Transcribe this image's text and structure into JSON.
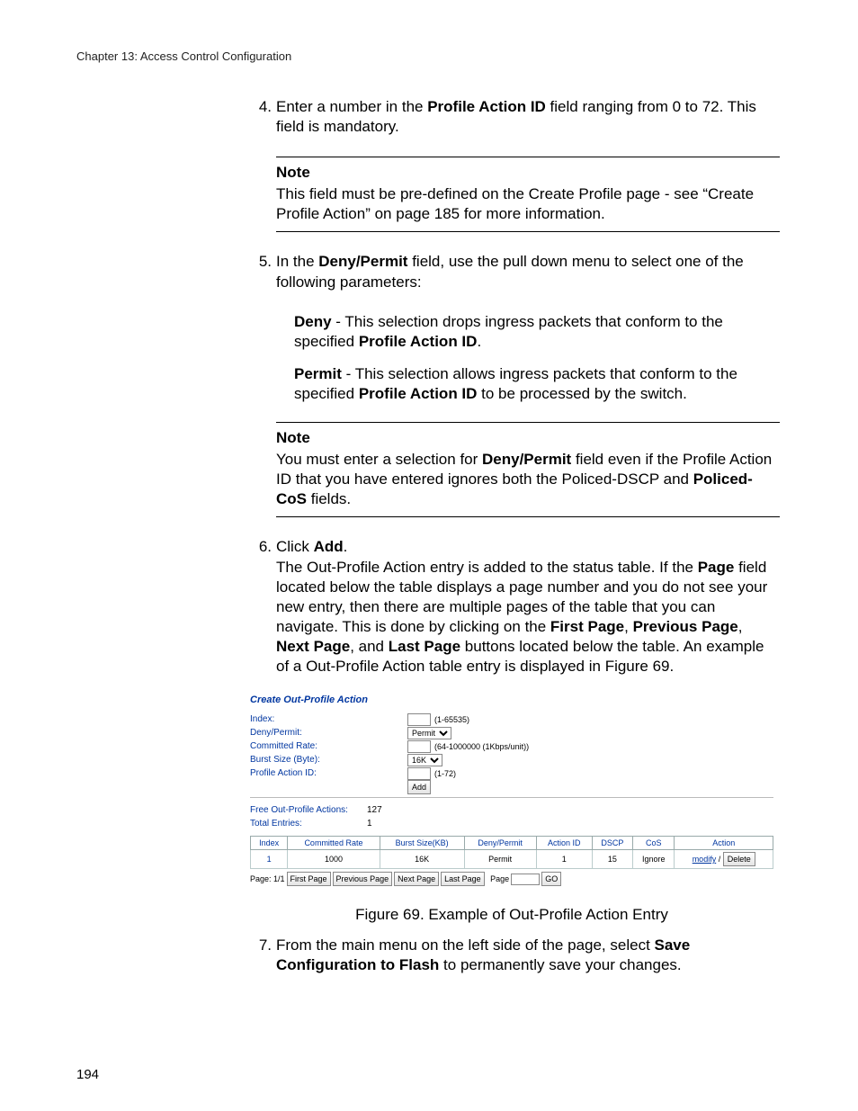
{
  "header": "Chapter 13: Access Control Configuration",
  "page_number": "194",
  "steps": {
    "s4": {
      "num": "4.",
      "text_pre": "Enter a number in the ",
      "bold1": "Profile Action ID",
      "text_mid": " field ranging from 0 to 72. This field is mandatory."
    },
    "note1": {
      "title": "Note",
      "body": "This field must be pre-defined on the Create Profile page - see “Create Profile Action” on page 185 for more information."
    },
    "s5": {
      "num": "5.",
      "text_pre": "In the ",
      "bold1": "Deny/Permit",
      "text_post": " field, use the pull down menu to select one of the following parameters:"
    },
    "deny": {
      "bold": "Deny",
      "text1": " - This selection drops ingress packets that conform to the specified ",
      "bold2": "Profile Action ID",
      "text2": "."
    },
    "permit": {
      "bold": "Permit",
      "text1": " - This selection allows ingress packets that conform to the specified ",
      "bold2": "Profile Action ID",
      "text2": " to be processed by the switch."
    },
    "note2": {
      "title": "Note",
      "p1a": "You must enter a selection for ",
      "p1b": "Deny/Permit",
      "p1c": " field even if the Profile Action ID that you have entered ignores both the Policed-DSCP and ",
      "p1d": "Policed-CoS",
      "p1e": " fields."
    },
    "s6": {
      "num": "6.",
      "pre": "Click ",
      "bold_add": "Add",
      "post_add": ".",
      "body1": "The Out-Profile Action entry is added to the status table. If the ",
      "bold_page": "Page",
      "body2": " field located below the table displays a page number and you do not see your new entry, then there are multiple pages of the table that you can navigate. This is done by clicking on the ",
      "b_first": "First Page",
      "sep1": ", ",
      "b_prev": "Previous Page",
      "sep2": ", ",
      "b_next": "Next Page",
      "sep3": ", and ",
      "b_last": "Last Page",
      "body3": " buttons located below the table. An example of a Out-Profile Action table entry is displayed in Figure 69."
    },
    "s7": {
      "num": "7.",
      "pre": "From the main menu on the left side of the page, select ",
      "b1": "Save Configuration to Flash",
      "post": " to permanently save your changes."
    }
  },
  "figure": {
    "caption": "Figure 69. Example of Out-Profile Action Entry",
    "title": "Create Out-Profile Action",
    "labels": {
      "index": "Index:",
      "deny_permit": "Deny/Permit:",
      "committed_rate": "Committed Rate:",
      "burst_size": "Burst Size (Byte):",
      "profile_action_id": "Profile Action ID:"
    },
    "hints": {
      "index": "(1-65535)",
      "committed_rate": "(64-1000000 (1Kbps/unit))",
      "profile_action_id": "(1-72)"
    },
    "selects": {
      "deny_permit": "Permit",
      "burst_size": "16K"
    },
    "buttons": {
      "add": "Add",
      "first": "First Page",
      "prev": "Previous Page",
      "next": "Next Page",
      "last": "Last Page",
      "go": "GO",
      "delete": "Delete"
    },
    "stats": {
      "free_label": "Free Out-Profile Actions:",
      "free_value": "127",
      "total_label": "Total Entries:",
      "total_value": "1"
    },
    "table": {
      "headers": [
        "Index",
        "Committed Rate",
        "Burst Size(KB)",
        "Deny/Permit",
        "Action ID",
        "DSCP",
        "CoS",
        "Action"
      ],
      "row": {
        "index": "1",
        "rate": "1000",
        "burst": "16K",
        "dp": "Permit",
        "aid": "1",
        "dscp": "15",
        "cos": "Ignore",
        "modify": "modify"
      }
    },
    "pager": {
      "label": "Page: 1/1",
      "page_field_label": "Page"
    }
  }
}
